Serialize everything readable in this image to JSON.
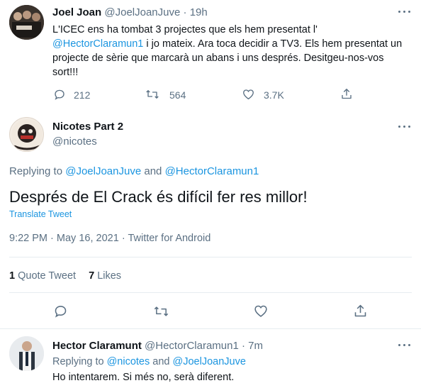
{
  "tweet1": {
    "name": "Joel Joan",
    "handle": "@JoelJoanJuve",
    "sep": "·",
    "time": "19h",
    "text_a": "L'ICEC ens ha tombat 3 projectes que els hem presentat l'",
    "mention": "@HectorClaramun1",
    "text_b": " i jo mateix. Ara toca decidir a TV3. Els hem presentat un projecte de sèrie que marcarà un abans i uns després. Desitgeu-nos-vos sort!!!",
    "replies": "212",
    "retweets": "564",
    "likes": "3.7K"
  },
  "main": {
    "name": "Nicotes Part 2",
    "handle": "@nicotes",
    "replying_prefix": "Replying to",
    "reply_user1": "@JoelJoanJuve",
    "reply_and": "and",
    "reply_user2": "@HectorClaramun1",
    "text": "Després de El Crack és difícil fer res millor!",
    "translate": "Translate Tweet",
    "time": "9:22 PM",
    "date": "May 16, 2021",
    "sep": "·",
    "source": "Twitter for Android",
    "quote_count": "1",
    "quote_label": "Quote Tweet",
    "likes_count": "7",
    "likes_label": "Likes"
  },
  "reply": {
    "name": "Hector Claramunt",
    "handle": "@HectorClaramun1",
    "sep": "·",
    "time": "7m",
    "replying_prefix": "Replying to",
    "reply_user1": "@nicotes",
    "reply_and": "and",
    "reply_user2": "@JoelJoanJuve",
    "text": "Ho intentarem. Si més no, serà diferent."
  },
  "colors": {
    "accent": "#1b95e0",
    "secondary": "#5b7083",
    "divider": "#e6ecf0"
  }
}
